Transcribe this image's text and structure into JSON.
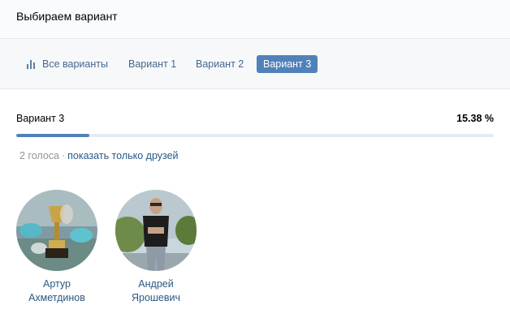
{
  "header": {
    "title": "Выбираем вариант"
  },
  "tabs": {
    "all": {
      "label": "Все варианты",
      "icon": "bar-chart-icon"
    },
    "items": [
      {
        "label": "Вариант 1",
        "active": false
      },
      {
        "label": "Вариант 2",
        "active": false
      },
      {
        "label": "Вариант 3",
        "active": true
      }
    ]
  },
  "result": {
    "variant_label": "Вариант 3",
    "percent_text": "15.38 %",
    "percent_value": 15.38,
    "votes_text": "2 голоса",
    "separator": "·",
    "friends_link": "показать только друзей"
  },
  "voters": [
    {
      "first_name": "Артур",
      "last_name": "Ахметдинов"
    },
    {
      "first_name": "Андрей",
      "last_name": "Ярошевич"
    }
  ],
  "colors": {
    "accent": "#5181b8",
    "link": "#2a5885",
    "muted": "#939393",
    "track": "#e5ebf1"
  }
}
